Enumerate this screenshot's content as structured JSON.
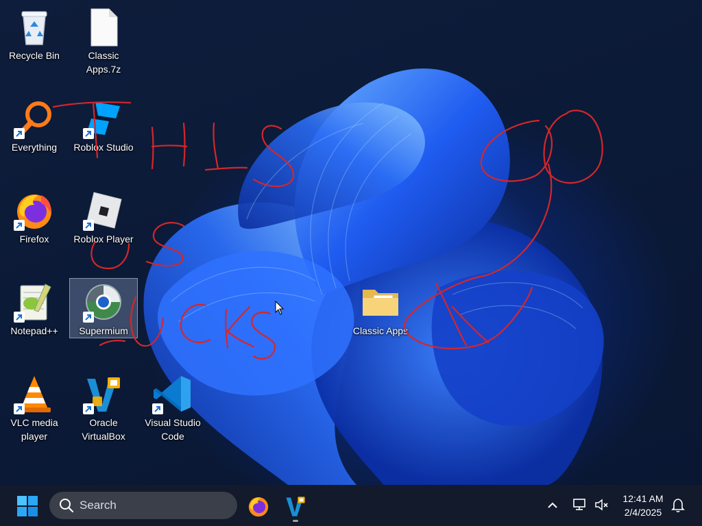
{
  "desktop": {
    "icons": [
      {
        "label": "Recycle Bin",
        "icon": "recycle-bin-icon"
      },
      {
        "label": "Classic Apps.7z",
        "icon": "file-icon"
      },
      {
        "label": "Everything",
        "icon": "everything-search-icon"
      },
      {
        "label": "Roblox Studio",
        "icon": "roblox-studio-icon"
      },
      {
        "label": "Firefox",
        "icon": "firefox-icon"
      },
      {
        "label": "Roblox Player",
        "icon": "roblox-player-icon"
      },
      {
        "label": "Notepad++",
        "icon": "notepad-plus-plus-icon"
      },
      {
        "label": "Supermium",
        "icon": "supermium-icon"
      },
      {
        "label": "Classic Apps",
        "icon": "folder-icon"
      },
      {
        "label": "VLC media player",
        "icon": "vlc-icon"
      },
      {
        "label": "Oracle VirtualBox",
        "icon": "virtualbox-icon"
      },
      {
        "label": "Visual Studio Code",
        "icon": "vscode-icon"
      }
    ],
    "scribble_color": "#d6262a"
  },
  "taskbar": {
    "search_placeholder": "Search",
    "pinned": [
      "firefox-icon",
      "virtualbox-icon"
    ],
    "clock": {
      "time": "12:41 AM",
      "date": "2/4/2025"
    },
    "colors": {
      "background": "#121a2b",
      "search_bg": "#3a3f4a"
    }
  }
}
